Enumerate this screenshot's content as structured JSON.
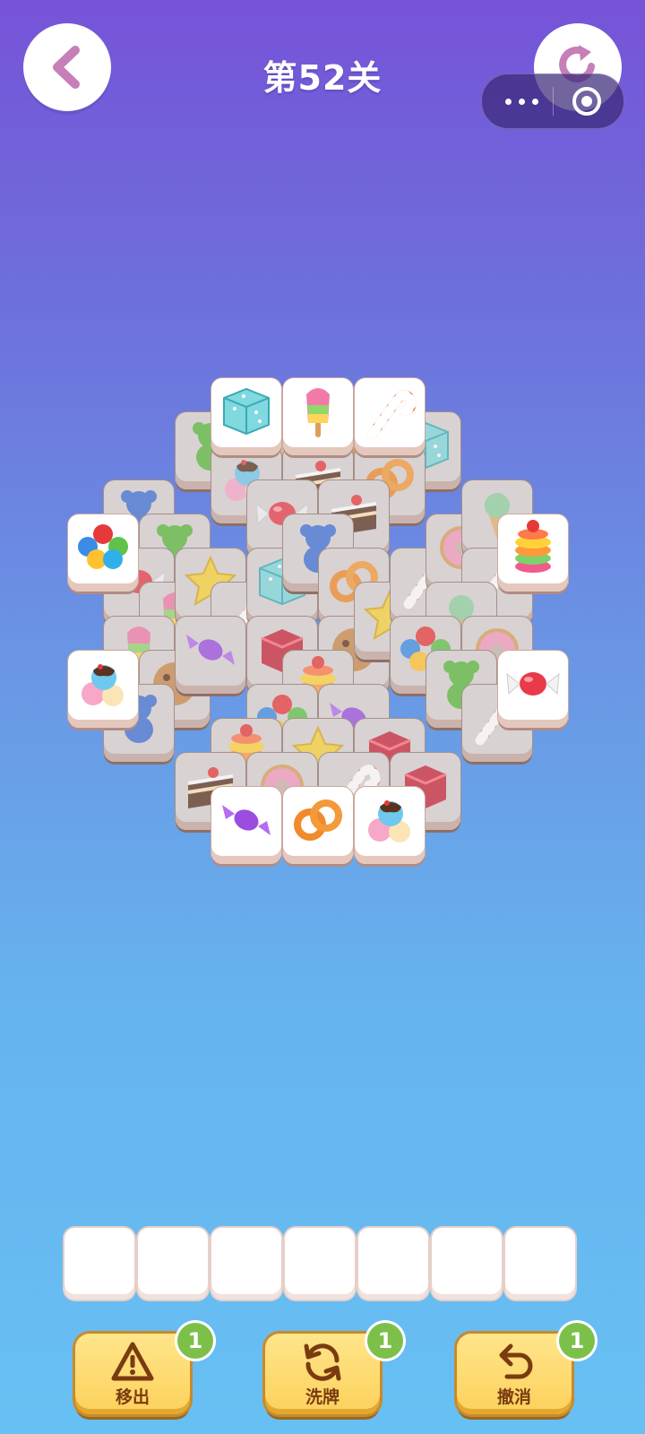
{
  "header": {
    "title": "第52关"
  },
  "tools": [
    {
      "label": "移出",
      "count": "1",
      "icon": "warning-icon"
    },
    {
      "label": "洗牌",
      "count": "1",
      "icon": "shuffle-icon"
    },
    {
      "label": "撤消",
      "count": "1",
      "icon": "undo-icon"
    }
  ],
  "tray": {
    "capacity": 7,
    "filled": 0
  },
  "colors": {
    "background_top": "#7653d8",
    "background_bottom": "#67c0f3",
    "tile_face": "#ffffff",
    "tool_button": "#fcd15c",
    "badge": "#7cc04a"
  },
  "tiles_top_layer": [
    "sugar-cube",
    "popsicle",
    "candy-cane",
    "gumballs",
    "macaron-stack",
    "ice-cream-scoops",
    "wrapped-candy",
    "purple-candy",
    "pretzel-ring",
    "ice-cream-scoops"
  ]
}
